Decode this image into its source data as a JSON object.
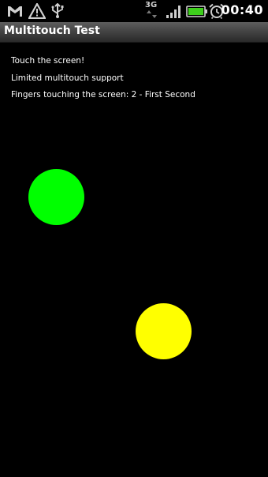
{
  "status_bar": {
    "icons": [
      "gmail-icon",
      "warning-icon",
      "usb-icon",
      "3g-data-icon",
      "signal-icon",
      "battery-icon",
      "alarm-icon"
    ],
    "network_label": "3G",
    "time": "00:40",
    "colors": {
      "battery": "#3ecf1c",
      "icons": "#cfcfcf"
    }
  },
  "app": {
    "title": "Multitouch Test"
  },
  "content": {
    "line1": "Touch the screen!",
    "line2": "Limited multitouch support",
    "line3": "Fingers touching the screen: 2 - First Second"
  },
  "touches": [
    {
      "name": "first",
      "color": "#00ff00"
    },
    {
      "name": "second",
      "color": "#ffff00"
    }
  ]
}
